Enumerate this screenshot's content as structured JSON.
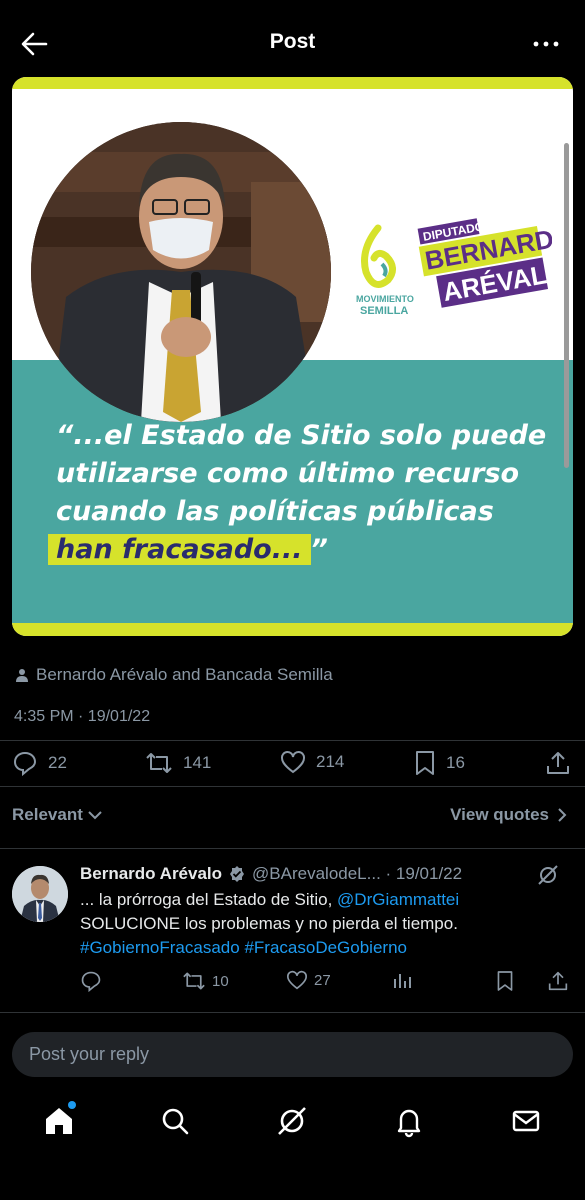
{
  "header": {
    "title": "Post"
  },
  "media": {
    "quote_lines": [
      "“...el Estado de Sitio solo puede",
      "utilizarse como último recurso",
      "cuando las políticas públicas"
    ],
    "quote_highlight": "han fracasado...",
    "quote_end": "”",
    "logo": {
      "org_line1": "MOVIMIENTO",
      "org_line2": "SEMILLA",
      "badge_top": "DIPUTADO",
      "badge_name1": "BERNARDO",
      "badge_name2": "ARÉVALO"
    }
  },
  "post": {
    "reposters": "Bernardo Arévalo and Bancada Semilla",
    "timestamp": "4:35 PM · 19/01/22",
    "replies": "22",
    "reposts": "141",
    "likes": "214",
    "bookmarks": "16"
  },
  "sort": {
    "label": "Relevant",
    "view_quotes": "View quotes"
  },
  "reply": {
    "name": "Bernardo Arévalo",
    "handle": "@BArevalodeL... · 19/01/22",
    "text_1": "... la  prórroga del Estado de Sitio, ",
    "mention": "@DrGiammattei",
    "text_2": "SOLUCIONE los problemas y no pierda el tiempo.",
    "hashtag_1": "#GobiernoFracasado",
    "hashtag_2": "#FracasoDeGobierno",
    "reposts": "10",
    "likes": "27"
  },
  "composer": {
    "placeholder": "Post your reply"
  },
  "colors": {
    "accent": "#1d9bf0",
    "lime": "#d6e22b",
    "teal": "#4aa6a0",
    "purple": "#5b2e87"
  }
}
